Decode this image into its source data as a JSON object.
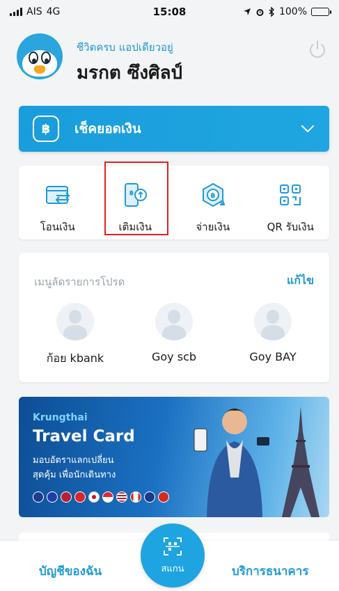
{
  "status": {
    "carrier": "AIS",
    "network": "4G",
    "time": "15:08",
    "battery": "100%",
    "battery_level": 1.0
  },
  "header": {
    "greeting": "ชีวิตครบ แอปเดียวอยู่",
    "user_name": "มรกต ซึงศิลป์"
  },
  "balance": {
    "currency_symbol": "฿",
    "label": "เช็คยอดเงิน"
  },
  "actions": [
    {
      "label": "โอนเงิน",
      "icon": "transfer-icon"
    },
    {
      "label": "เติมเงิน",
      "icon": "topup-icon"
    },
    {
      "label": "จ่ายเงิน",
      "icon": "pay-icon"
    },
    {
      "label": "QR รับเงิน",
      "icon": "qr-receive-icon"
    }
  ],
  "favorites": {
    "title": "เมนูลัดรายการโปรด",
    "edit_label": "แก้ไข",
    "items": [
      {
        "name": "ก้อย kbank"
      },
      {
        "name": "Goy scb"
      },
      {
        "name": "Goy BAY"
      }
    ]
  },
  "banner": {
    "brand": "Krungthai",
    "title": "Travel Card",
    "line1": "มอบอัตราแลกเปลี่ยน",
    "line2": "สุดคุ้ม เพื่อนักเดินทาง"
  },
  "bottom_nav": {
    "left_label": "บัญชีของฉัน",
    "center_label": "สแกน",
    "right_label": "บริการธนาคาร"
  },
  "colors": {
    "accent": "#1f9ad6",
    "highlight": "#e02020"
  }
}
